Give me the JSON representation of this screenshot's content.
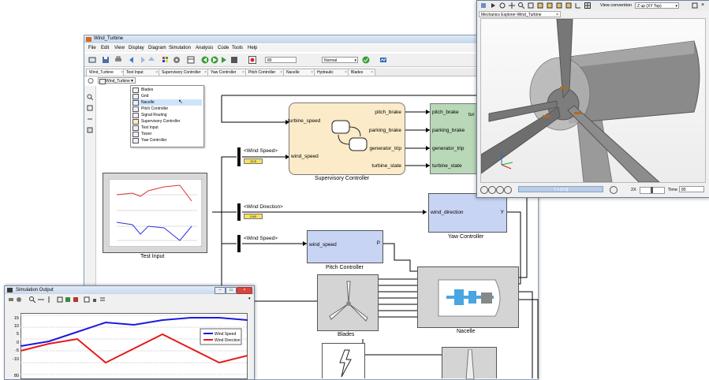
{
  "main_window": {
    "title": "Wind_Turbine",
    "menu": [
      "File",
      "Edit",
      "View",
      "Display",
      "Diagram",
      "Simulation",
      "Analysis",
      "Code",
      "Tools",
      "Help"
    ],
    "stop_time": "80",
    "sim_mode": "Normal",
    "tabs": [
      "Wind_Turbine",
      "Test Input",
      "Supervisory Controller",
      "Yaw Controller",
      "Pitch Controller",
      "Nacelle",
      "Hydraulic",
      "Blades"
    ],
    "address": "Wind_Turbine",
    "dropdown_items": [
      {
        "label": "Blades",
        "selected": false
      },
      {
        "label": "Grid",
        "selected": false
      },
      {
        "label": "Nacelle",
        "selected": true
      },
      {
        "label": "Pitch Controller",
        "selected": false
      },
      {
        "label": "Signal Routing",
        "selected": false
      },
      {
        "label": "Supervisory Controller",
        "selected": false
      },
      {
        "label": "Test Input",
        "selected": false
      },
      {
        "label": "Tower",
        "selected": false
      },
      {
        "label": "Yaw Controller",
        "selected": false
      }
    ]
  },
  "blocks": {
    "supervisory": {
      "name": "Supervisory Controller",
      "inputs": [
        "turbine_speed",
        "wind_speed"
      ],
      "outputs": [
        "pitch_brake",
        "parking_brake",
        "generator_trip",
        "turbine_state"
      ]
    },
    "routing_inputs": [
      "pitch_brake",
      "parking_brake",
      "generator_trip",
      "turbine_state"
    ],
    "routing_partial": "tur",
    "test_input": {
      "name": "Test Input"
    },
    "yaw": {
      "name": "Yaw Controller",
      "input": "wind_direction",
      "output": "Y"
    },
    "pitch": {
      "name": "Pitch Controller",
      "input": "wind_speed",
      "output": "P"
    },
    "blades": {
      "name": "Blades"
    },
    "nacelle": {
      "name": "Nacelle"
    },
    "bus_labels": [
      "<Wind Speed>",
      "<Wind Direction>",
      "<Wind Speed>"
    ],
    "displays": [
      "12.5",
      "2.60"
    ]
  },
  "mechanics": {
    "tab": "Mechanics Explorer-Wind_Turbine",
    "view_convention_label": "View convention",
    "view_convention_value": "Z up (XY Top)",
    "time_readout": "T = [0.0]",
    "speed": "2X",
    "time_label": "Time",
    "time_value": "80"
  },
  "sim_output": {
    "title": "Simulation Output",
    "legend": [
      "Wind Speed",
      "Wind Direction"
    ],
    "yticks": [
      "15",
      "10",
      "5",
      "0",
      "-5",
      "-10"
    ],
    "yticks_bottom": [
      "80"
    ]
  },
  "colors": {
    "wind_speed": "#1a1adc",
    "wind_direction": "#e31a1a",
    "block_blue": "#c8d4f4",
    "block_tan": "#fcebc8",
    "block_green": "#b8d8b8"
  },
  "chart_data": {
    "type": "line",
    "x": [
      0,
      10,
      20,
      30,
      40,
      50,
      60,
      70,
      80
    ],
    "series": [
      {
        "name": "Wind Speed",
        "values": [
          2,
          4,
          8,
          12,
          11,
          13,
          14,
          14,
          13
        ]
      },
      {
        "name": "Wind Direction",
        "values": [
          0,
          3,
          5,
          -5,
          1,
          7,
          1,
          -5,
          -2
        ]
      }
    ],
    "ylim": [
      -12,
      16
    ]
  }
}
